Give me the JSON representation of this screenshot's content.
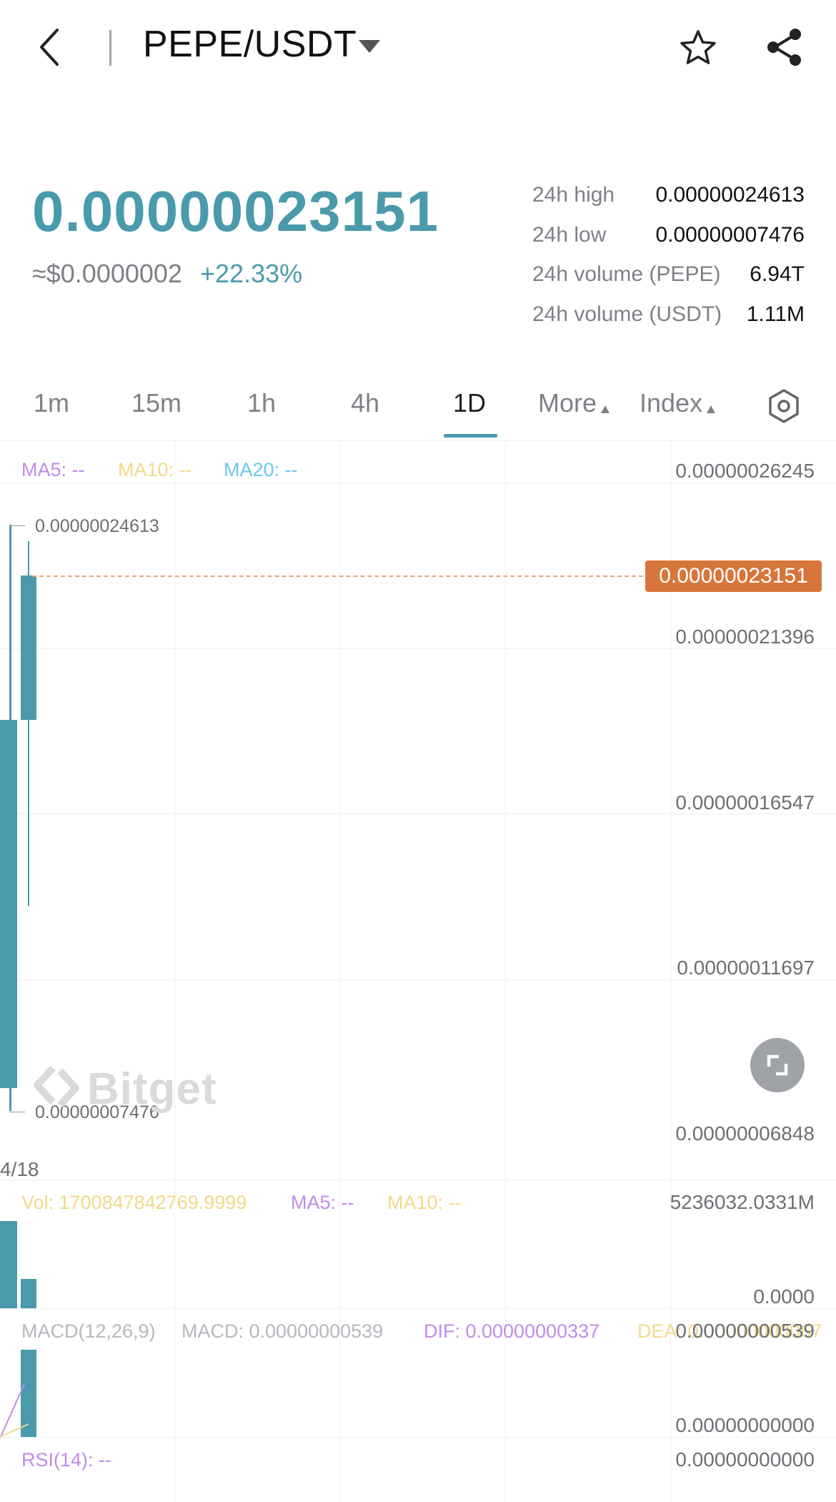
{
  "header": {
    "pair": "PEPE/USDT",
    "icons": [
      "back-arrow-icon",
      "caret-down-icon",
      "star-icon",
      "share-icon"
    ]
  },
  "ticker": {
    "last_price": "0.00000023151",
    "usd_price": "≈$0.0000002",
    "change": "+22.33%",
    "stats": [
      {
        "label": "24h high",
        "value": "0.00000024613"
      },
      {
        "label": "24h low",
        "value": "0.00000007476"
      },
      {
        "label": "24h volume (PEPE)",
        "value": "6.94T"
      },
      {
        "label": "24h volume (USDT)",
        "value": "1.11M"
      }
    ]
  },
  "tabs": [
    {
      "label": "1m"
    },
    {
      "label": "15m"
    },
    {
      "label": "1h"
    },
    {
      "label": "4h"
    },
    {
      "label": "1D",
      "active": true
    },
    {
      "label": "More"
    },
    {
      "label": "Index"
    }
  ],
  "chart": {
    "ma_legend": {
      "ma5": "MA5: --",
      "ma10": "MA10: --",
      "ma20": "MA20: --"
    },
    "axis": [
      "0.00000026245",
      "0.00000021396",
      "0.00000016547",
      "0.00000011697",
      "0.00000006848"
    ],
    "high_label": "0.00000024613",
    "low_label": "0.00000007476",
    "current_price_tag": "0.00000023151",
    "watermark": "Bitget",
    "date_label": "4/18"
  },
  "volume": {
    "vol": "Vol: 1700847842769.9999",
    "ma5": "MA5: --",
    "ma10": "MA10: --",
    "axis_top": "5236032.0331M",
    "axis_bottom": "0.0000"
  },
  "macd": {
    "title": "MACD(12,26,9)",
    "macd": "MACD: 0.00000000539",
    "dif": "DIF: 0.00000000337",
    "dea": "DEA: 0.00000000067",
    "axis_top": "0.00000000539",
    "axis_bottom": "0.00000000000"
  },
  "rsi": {
    "title": "RSI(14): --",
    "axis": "0.00000000000"
  },
  "colors": {
    "accent": "#4a9aab",
    "price_tag": "#d8753a",
    "ma5": "#c08be8",
    "ma10": "#f1d98a",
    "ma20": "#6cc8ea"
  }
}
